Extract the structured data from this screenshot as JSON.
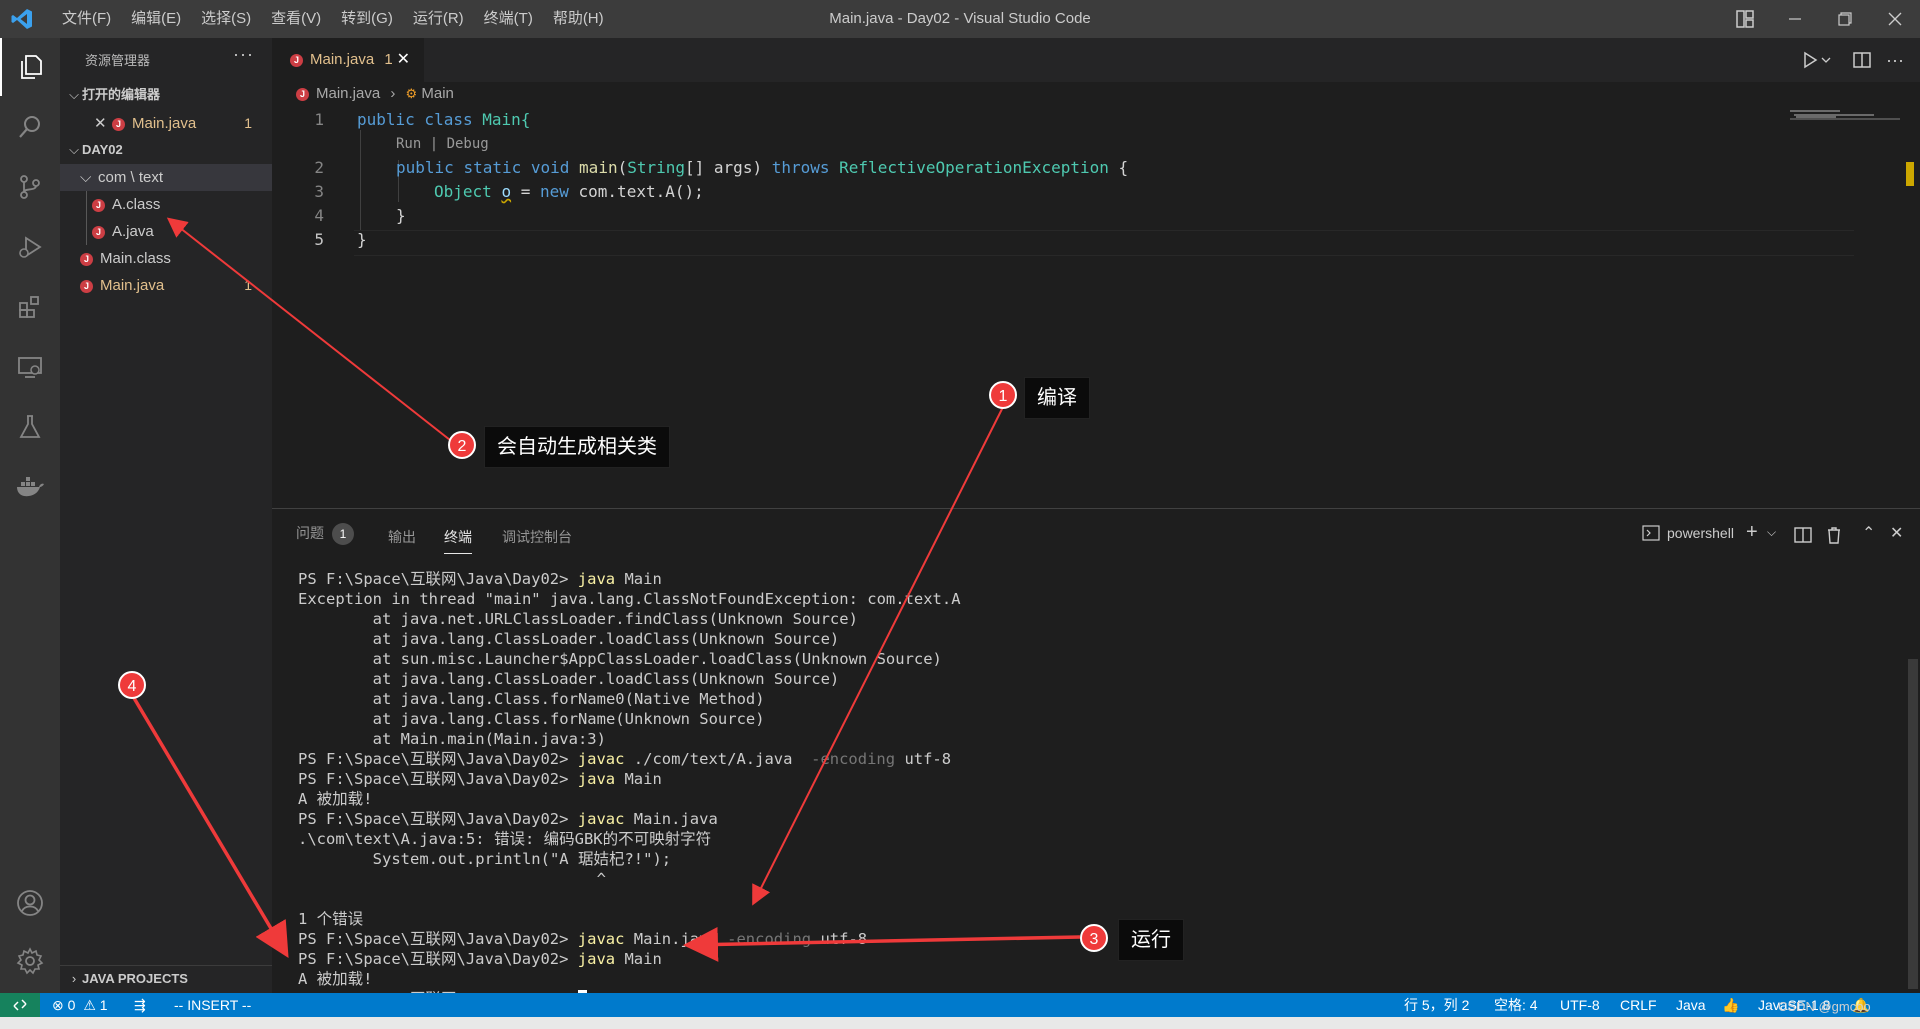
{
  "window": {
    "title": "Main.java - Day02 - Visual Studio Code",
    "menu": [
      "文件(F)",
      "编辑(E)",
      "选择(S)",
      "查看(V)",
      "转到(G)",
      "运行(R)",
      "终端(T)",
      "帮助(H)"
    ]
  },
  "sidebar": {
    "header": "资源管理器",
    "more": "···",
    "open_editors": {
      "title": "打开的编辑器",
      "items": [
        {
          "name": "Main.java",
          "badge": "1"
        }
      ]
    },
    "workspace": {
      "title": "DAY02",
      "folder": "com \\ text",
      "files_in_folder": [
        "A.class",
        "A.java"
      ],
      "root_files": [
        {
          "name": "Main.class",
          "badge": ""
        },
        {
          "name": "Main.java",
          "badge": "1"
        }
      ]
    },
    "java_projects": "JAVA PROJECTS"
  },
  "editor": {
    "tab": {
      "label": "Main.java",
      "badge": "1"
    },
    "breadcrumb": {
      "file": "Main.java",
      "symbol": "Main"
    },
    "codelens": "Run | Debug",
    "line_numbers": [
      "1",
      "2",
      "3",
      "4",
      "5"
    ],
    "code": {
      "line1": {
        "kw": "public class",
        "name": "Main{"
      },
      "line2": {
        "kw1": "public",
        "kw2": "static",
        "kw3": "void",
        "fn": "main",
        "paren": "(",
        "ty": "String",
        "rest": "[] args) ",
        "throws": "throws",
        "ex": "ReflectiveOperationException",
        "brace": " {"
      },
      "line3": {
        "ty": "Object",
        "var": "o",
        "eq": " = ",
        "kw": "new",
        "rest": " com.text.A();"
      },
      "line4": "}",
      "line5": "}"
    }
  },
  "panel": {
    "tabs": {
      "problems": "问题",
      "problems_count": "1",
      "output": "输出",
      "terminal": "终端",
      "debug": "调试控制台"
    },
    "shell": "powershell",
    "terminal": {
      "prompt": "PS F:\\Space\\互联网\\Java\\Day02> ",
      "l1_cmd": "java",
      "l1_arg": " Main",
      "exception": "Exception in thread \"main\" java.lang.ClassNotFoundException: com.text.A",
      "stack": [
        "        at java.net.URLClassLoader.findClass(Unknown Source)",
        "        at java.lang.ClassLoader.loadClass(Unknown Source)",
        "        at sun.misc.Launcher$AppClassLoader.loadClass(Unknown Source)",
        "        at java.lang.ClassLoader.loadClass(Unknown Source)",
        "        at java.lang.Class.forName0(Native Method)",
        "        at java.lang.Class.forName(Unknown Source)",
        "        at Main.main(Main.java:3)"
      ],
      "l2_cmd": "javac",
      "l2_arg": " ./com/text/A.java  ",
      "l2_flag": "-encoding",
      "l2_val": " utf-8",
      "l3_cmd": "java",
      "l3_arg": " Main",
      "loaded": "A 被加载!",
      "l4_cmd": "javac",
      "l4_arg": " Main.java",
      "err1": ".\\com\\text\\A.java:5: 错误: 编码GBK的不可映射字符",
      "err2": "        System.out.println(\"A 琚姞杞?!\");",
      "err3": "                                ^",
      "err4": "1 个错误",
      "l5_cmd": "javac",
      "l5_arg": " Main.java ",
      "l5_flag": "-encoding",
      "l5_val": " utf-8",
      "l6_cmd": "java",
      "l6_arg": " Main",
      "loaded2": "A 被加载!"
    }
  },
  "statusbar": {
    "errors": "0",
    "warnings": "1",
    "mode": "-- INSERT --",
    "position": "行 5，列 2",
    "spaces": "空格: 4",
    "encoding": "UTF-8",
    "eol": "CRLF",
    "language": "Java",
    "runtime": "JavaSE-1.8",
    "watermark": "CSDN @gmcoo"
  },
  "annotations": [
    {
      "num": "1",
      "label": "编译"
    },
    {
      "num": "2",
      "label": "会自动生成相关类"
    },
    {
      "num": "3",
      "label": "运行"
    },
    {
      "num": "4",
      "label": ""
    }
  ],
  "colors": {
    "accent": "#007acc",
    "annotation": "#ef3a3a",
    "modified": "#e2c08d"
  }
}
